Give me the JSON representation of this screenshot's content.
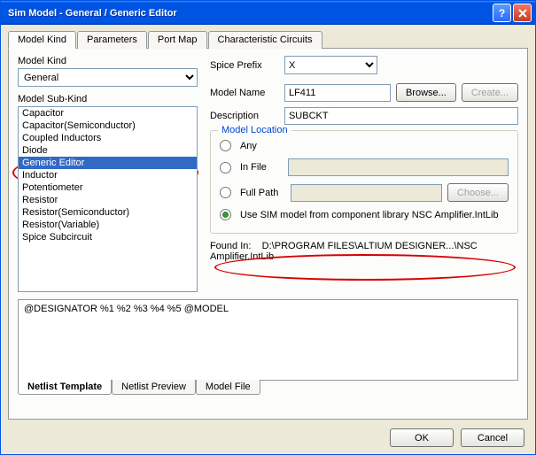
{
  "titlebar": {
    "title": "Sim Model - General / Generic Editor"
  },
  "tabs": {
    "model_kind": "Model Kind",
    "parameters": "Parameters",
    "port_map": "Port Map",
    "characteristic": "Characteristic Circuits"
  },
  "left": {
    "model_kind_label": "Model Kind",
    "model_kind_value": "General",
    "model_sub_kind_label": "Model Sub-Kind",
    "sub_kinds": [
      "Capacitor",
      "Capacitor(Semiconductor)",
      "Coupled Inductors",
      "Diode",
      "Generic Editor",
      "Inductor",
      "Potentiometer",
      "Resistor",
      "Resistor(Semiconductor)",
      "Resistor(Variable)",
      "Spice Subcircuit"
    ],
    "selected_sub_kind": "Generic Editor"
  },
  "right": {
    "spice_prefix_label": "Spice Prefix",
    "spice_prefix_value": "X",
    "model_name_label": "Model Name",
    "model_name_value": "LF411",
    "browse_btn": "Browse...",
    "create_btn": "Create...",
    "description_label": "Description",
    "description_value": "SUBCKT",
    "location": {
      "title": "Model Location",
      "any": "Any",
      "in_file": "In File",
      "full_path": "Full Path",
      "choose_btn": "Choose...",
      "use_sim": "Use SIM model from component library NSC Amplifier.IntLib"
    },
    "found_in_label": "Found In:",
    "found_in_value": "D:\\PROGRAM FILES\\ALTIUM DESIGNER...\\NSC Amplifier.IntLib"
  },
  "netlist": {
    "template_text": "@DESIGNATOR %1 %2 %3 %4 %5 @MODEL",
    "tabs": {
      "template": "Netlist Template",
      "preview": "Netlist Preview",
      "model_file": "Model File"
    }
  },
  "footer": {
    "ok": "OK",
    "cancel": "Cancel"
  }
}
